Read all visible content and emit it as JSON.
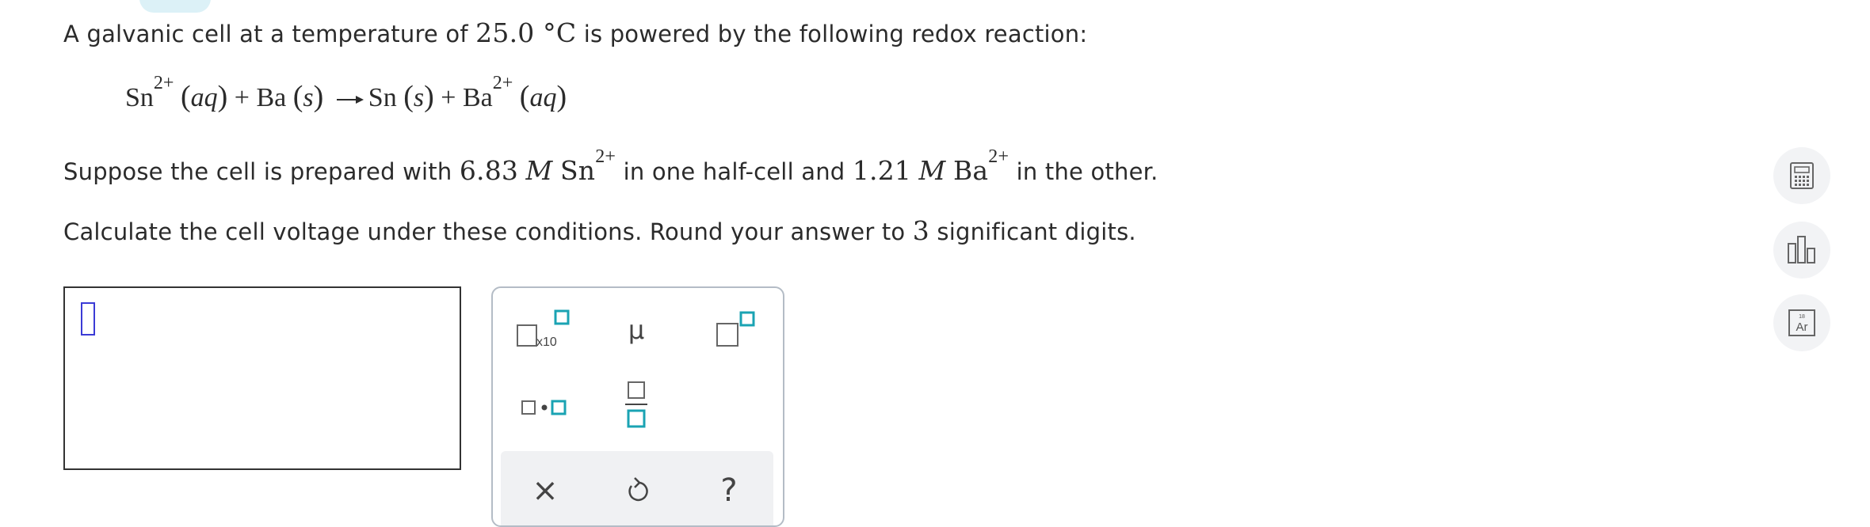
{
  "question": {
    "intro_before_temp": "A galvanic cell at a temperature of ",
    "temp_value": "25.0 °C",
    "intro_after_temp": " is powered by the following redox reaction:",
    "reaction": {
      "sn": "Sn",
      "ba": "Ba",
      "charge": "2+",
      "aq": "aq",
      "s": "s",
      "plus": "+"
    },
    "suppose_start": "Suppose the cell is prepared with ",
    "sn_conc": "6.83",
    "molar": "M",
    "sn_species": "Sn",
    "middle_text": " in one half-cell and ",
    "ba_conc": "1.21",
    "ba_species": "Ba",
    "end_text": " in the other.",
    "calc_start": "Calculate the cell voltage under these conditions. Round your answer to ",
    "sig_digits": "3",
    "calc_end": " significant digits."
  },
  "keypad": {
    "sci_label": "x10",
    "mu_label": "μ",
    "clear_label": "×",
    "help_label": "?"
  },
  "sidebar": {
    "periodic_number": "18",
    "periodic_symbol": "Ar"
  },
  "colors": {
    "accent": "#1aa3b3",
    "cursor": "#3b3bd6",
    "icon_gray": "#666666"
  }
}
